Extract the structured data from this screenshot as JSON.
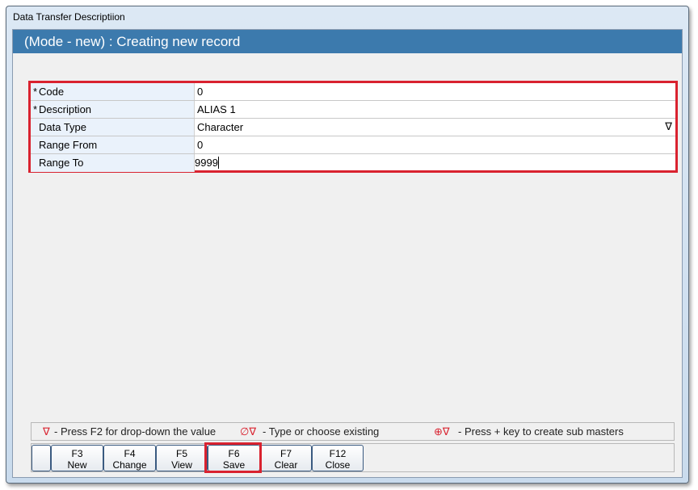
{
  "window": {
    "title": "Data Transfer Descriptiion"
  },
  "header": {
    "title": "(Mode - new) : Creating new record"
  },
  "form": {
    "fields": [
      {
        "label": "Code",
        "required": "*",
        "value": "0"
      },
      {
        "label": "Description",
        "required": "*",
        "value": "ALIAS 1"
      },
      {
        "label": "Data Type",
        "required": "",
        "value": "Character",
        "dropdown": "∇"
      },
      {
        "label": "Range From",
        "required": "",
        "value": "0"
      },
      {
        "label": "Range To",
        "required": "",
        "value": "9999"
      }
    ]
  },
  "legend": {
    "dropdown_icon": "∇",
    "dropdown_text": "- Press F2 for drop-down the value",
    "existing_icon": "∅∇",
    "existing_text": "- Type or choose existing",
    "sub_icon": "⊕∇",
    "sub_text": "- Press + key to create sub masters"
  },
  "buttons": [
    {
      "key": "F3",
      "label": "New"
    },
    {
      "key": "F4",
      "label": "Change"
    },
    {
      "key": "F5",
      "label": "View"
    },
    {
      "key": "F6",
      "label": "Save"
    },
    {
      "key": "F7",
      "label": "Clear"
    },
    {
      "key": "F12",
      "label": "Close"
    }
  ],
  "colors": {
    "header": "#3c7aad",
    "highlight": "#d9222f"
  }
}
